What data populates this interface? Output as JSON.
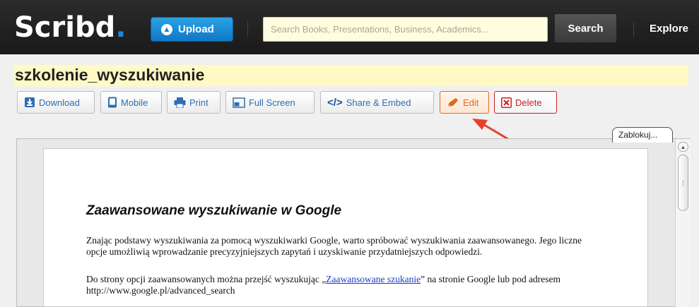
{
  "header": {
    "logo_text": "Scribd",
    "logo_dot": ".",
    "upload_label": "Upload",
    "search_placeholder": "Search Books, Presentations, Business, Academics...",
    "search_button": "Search",
    "explore_label": "Explore"
  },
  "document": {
    "title": "szkolenie_wyszukiwanie"
  },
  "toolbar": {
    "download": "Download",
    "mobile": "Mobile",
    "print": "Print",
    "fullscreen": "Full Screen",
    "share_embed": "Share & Embed",
    "edit": "Edit",
    "delete": "Delete"
  },
  "viewer": {
    "lock_tab": "Zablokuj...",
    "page_heading": "Zaawansowane wyszukiwanie w Google",
    "para1": "Znając podstawy wyszukiwania za pomocą wyszukiwarki Google, warto spróbować wyszukiwania zaawansowanego. Jego liczne opcje umożliwią wprowadzanie precyzyjniejszych zapytań i uzyskiwanie przydatniejszych odpowiedzi.",
    "para2_before": "Do strony opcji zaawansowanych można przejść wyszukując „",
    "para2_link": "Zaawansowane szukanie",
    "para2_after": "” na stronie Google lub pod adresem http://www.google.pl/advanced_search"
  },
  "colors": {
    "topbar": "#1f1f1f",
    "accent_blue": "#1580cb",
    "title_highlight": "#fff9c4",
    "edit_orange": "#e06a1c",
    "delete_red": "#c92020",
    "arrow_red": "#e8402a"
  },
  "icons": {
    "upload": "arrow-up-circle-icon",
    "download": "download-icon",
    "mobile": "mobile-icon",
    "print": "printer-icon",
    "fullscreen": "fullscreen-icon",
    "share": "code-icon",
    "edit": "pencil-icon",
    "delete": "x-box-icon"
  }
}
